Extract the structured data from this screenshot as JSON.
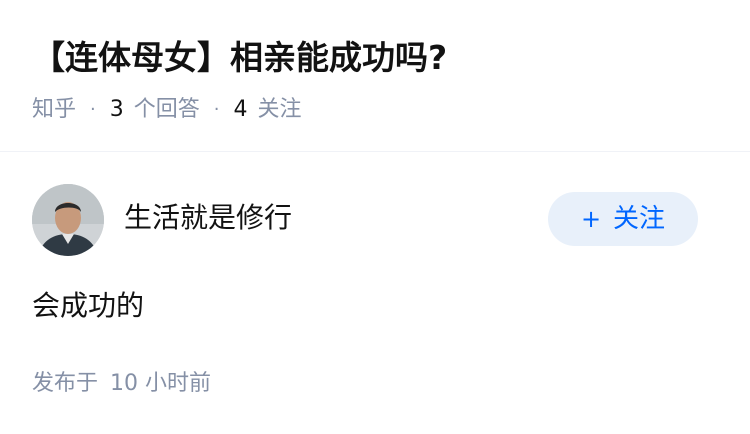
{
  "question": {
    "title": "【连体母女】相亲能成功吗?",
    "source": "知乎",
    "answer_count": "3",
    "answer_label": "个回答",
    "follow_count": "4",
    "follow_label": "关注"
  },
  "answer": {
    "author": {
      "name": "生活就是修行",
      "avatar_icon": "user-avatar"
    },
    "follow_button": {
      "label": "关注",
      "icon": "plus-icon"
    },
    "content": "会成功的",
    "published_label": "发布于",
    "published_time": "10 小时前"
  },
  "colors": {
    "accent": "#0066ff",
    "follow_bg": "#e8f0fa",
    "meta_gray": "#8590a6",
    "text": "#121212"
  }
}
